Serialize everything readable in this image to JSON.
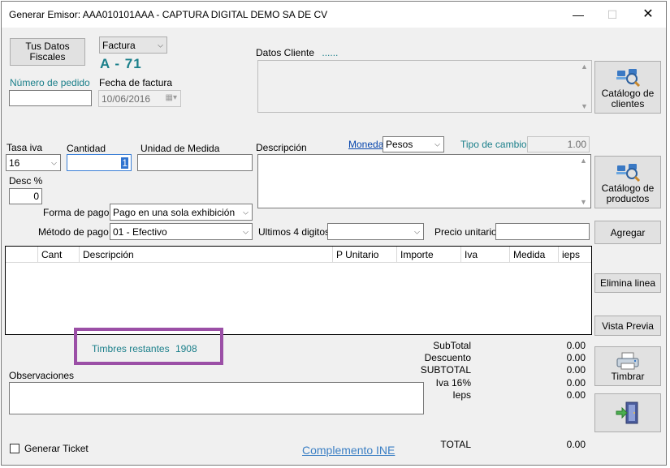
{
  "window": {
    "title": "Generar   Emisor: AAA010101AAA  -  CAPTURA DIGITAL DEMO SA DE CV",
    "minimize": "—",
    "maximize": "☐",
    "close": "✕"
  },
  "header": {
    "tus_datos_button": "Tus Datos\nFiscales",
    "doc_type": "Factura",
    "folio": "A - 71",
    "numero_pedido_label": "Número de pedido",
    "numero_pedido_value": "",
    "fecha_label": "Fecha de factura",
    "fecha_value": "10/06/2016",
    "datos_cliente_label": "Datos Cliente",
    "datos_cliente_dots": "......",
    "catalogo_clientes_button": "Catálogo de\nclientes"
  },
  "item": {
    "tasa_iva_label": "Tasa iva",
    "tasa_iva_value": "16",
    "cantidad_label": "Cantidad",
    "cantidad_value": "1",
    "unidad_label": "Unidad de Medida",
    "unidad_value": "",
    "descripcion_label": "Descripción",
    "moneda_label": "Moneda",
    "moneda_value": "Pesos",
    "tipo_cambio_label": "Tipo de cambio",
    "tipo_cambio_value": "1.00",
    "desc_label": "Desc %",
    "desc_value": "0",
    "catalogo_productos_button": "Catálogo de\nproductos",
    "forma_pago_label": "Forma de pago",
    "forma_pago_value": "Pago en una sola exhibición",
    "metodo_pago_label": "Método de pago",
    "metodo_pago_value": "01 - Efectivo",
    "ultimos_label": "Ultimos 4 digitos",
    "ultimos_value": "",
    "precio_label": "Precio unitario",
    "precio_value": "",
    "agregar_button": "Agregar"
  },
  "grid": {
    "columns": [
      "Cant",
      "Descripción",
      "P Unitario",
      "Importe",
      "Iva",
      "Medida",
      "ieps"
    ]
  },
  "actions": {
    "elimina_button": "Elimina linea",
    "vista_button": "Vista Previa",
    "timbrar_button": "Timbrar"
  },
  "footer": {
    "timbres_label": "Timbres restantes",
    "timbres_value": "1908",
    "observaciones_label": "Observaciones",
    "generar_ticket_label": "Generar Ticket",
    "complemento_link": "Complemento INE",
    "highlight_color": "#9b4fa6"
  },
  "totals": {
    "rows": [
      {
        "label": "SubTotal",
        "value": "0.00"
      },
      {
        "label": "Descuento",
        "value": "0.00"
      },
      {
        "label": "SUBTOTAL",
        "value": "0.00"
      },
      {
        "label": "Iva 16%",
        "value": "0.00"
      },
      {
        "label": "Ieps",
        "value": "0.00"
      }
    ],
    "total_label": "TOTAL",
    "total_value": "0.00"
  }
}
